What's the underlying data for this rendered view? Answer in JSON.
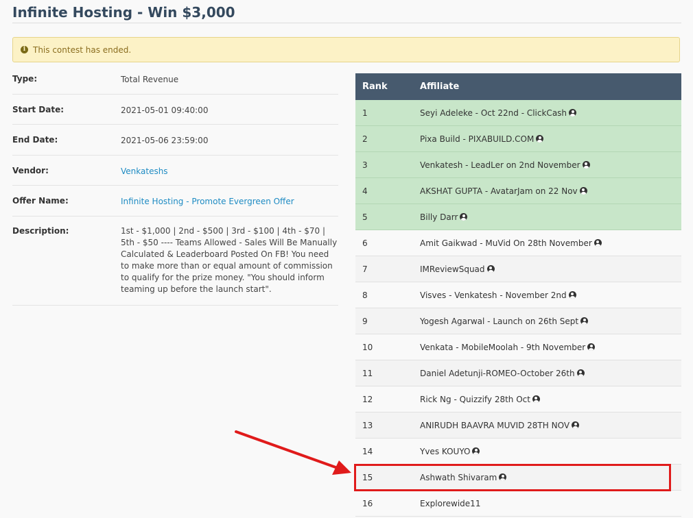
{
  "page": {
    "title": "Infinite Hosting - Win $3,000"
  },
  "alert": {
    "text": "This contest has ended.",
    "icon": "info-icon"
  },
  "details": {
    "type_label": "Type:",
    "type_value": "Total Revenue",
    "start_label": "Start Date:",
    "start_value": "2021-05-01 09:40:00",
    "end_label": "End Date:",
    "end_value": "2021-05-06 23:59:00",
    "vendor_label": "Vendor:",
    "vendor_value": "Venkateshs",
    "offer_label": "Offer Name:",
    "offer_value": "Infinite Hosting - Promote Evergreen Offer",
    "description_label": "Description:",
    "description_value": "1st - $1,000 | 2nd - $500 | 3rd - $100 | 4th - $70 | 5th - $50 ---- Teams Allowed - Sales Will Be Manually Calculated & Leaderboard Posted On FB! You need to make more than or equal amount of commission to qualify for the prize money. \"You should inform teaming up before the launch start\"."
  },
  "leaderboard": {
    "col_rank": "Rank",
    "col_affiliate": "Affiliate",
    "rows": [
      {
        "rank": "1",
        "name": "Seyi Adeleke - Oct 22nd - ClickCash",
        "icon": true
      },
      {
        "rank": "2",
        "name": "Pixa Build - PIXABUILD.COM",
        "icon": true
      },
      {
        "rank": "3",
        "name": "Venkatesh - LeadLer on 2nd November",
        "icon": true
      },
      {
        "rank": "4",
        "name": "AKSHAT GUPTA - AvatarJam on 22 Nov",
        "icon": true
      },
      {
        "rank": "5",
        "name": "Billy Darr",
        "icon": true
      },
      {
        "rank": "6",
        "name": "Amit Gaikwad - MuVid On 28th November",
        "icon": true
      },
      {
        "rank": "7",
        "name": "IMReviewSquad",
        "icon": true
      },
      {
        "rank": "8",
        "name": "Visves - Venkatesh - November 2nd",
        "icon": true
      },
      {
        "rank": "9",
        "name": "Yogesh Agarwal - Launch on 26th Sept",
        "icon": true
      },
      {
        "rank": "10",
        "name": "Venkata - MobileMoolah - 9th November",
        "icon": true
      },
      {
        "rank": "11",
        "name": "Daniel Adetunji-ROMEO-October 26th",
        "icon": true
      },
      {
        "rank": "12",
        "name": "Rick Ng - Quizzify 28th Oct",
        "icon": true
      },
      {
        "rank": "13",
        "name": "ANIRUDH BAAVRA MUVID 28TH NOV",
        "icon": true
      },
      {
        "rank": "14",
        "name": "Yves KOUYO",
        "icon": true
      },
      {
        "rank": "15",
        "name": "Ashwath Shivaram",
        "icon": true
      },
      {
        "rank": "16",
        "name": "Explorewide11",
        "icon": false
      }
    ],
    "winner_count": 5,
    "highlighted_rank": "15"
  },
  "colors": {
    "header_bg": "#475a6e",
    "winner_bg": "#c8e6c9",
    "link": "#1e8bc3",
    "annotation": "#e01b1b"
  }
}
